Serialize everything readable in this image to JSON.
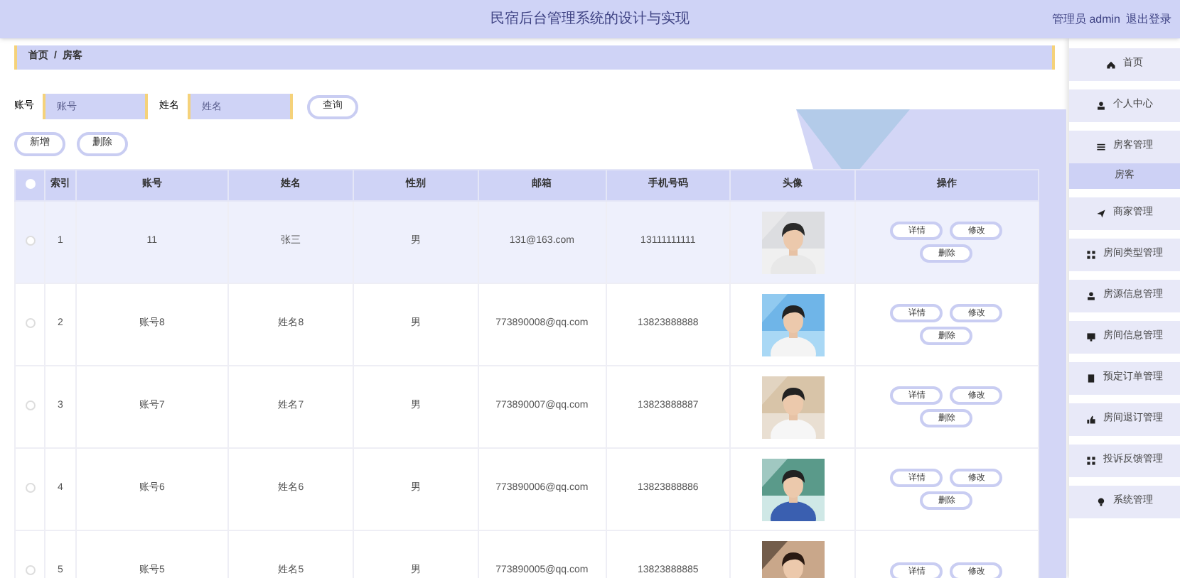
{
  "header": {
    "title": "民宿后台管理系统的设计与实现",
    "user": "管理员 admin",
    "logout": "退出登录"
  },
  "breadcrumb": [
    "首页",
    "/",
    "房客"
  ],
  "search": [
    {
      "label": "账号",
      "placeholder": "账号"
    },
    {
      "label": "姓名",
      "placeholder": "姓名"
    }
  ],
  "search_button": "查询",
  "actions": [
    "新增",
    "删除"
  ],
  "table": {
    "select_all": false,
    "columns": [
      "索引",
      "账号",
      "姓名",
      "性别",
      "邮箱",
      "手机号码",
      "头像",
      "操作"
    ],
    "rows": [
      {
        "checked": false,
        "hovered": true,
        "cells": [
          "1",
          "11",
          "张三",
          "男",
          "131@163.com",
          "13111111111"
        ],
        "avatar": {
          "kind": "picture"
        },
        "actions": [
          "详情",
          "修改",
          "删除"
        ]
      },
      {
        "checked": false,
        "hovered": false,
        "cells": [
          "2",
          "账号8",
          "姓名8",
          "男",
          "773890008@qq.com",
          "13823888888"
        ],
        "avatar": {
          "kind": "picture"
        },
        "actions": [
          "详情",
          "修改",
          "删除"
        ]
      },
      {
        "checked": false,
        "hovered": false,
        "cells": [
          "3",
          "账号7",
          "姓名7",
          "男",
          "773890007@qq.com",
          "13823888887"
        ],
        "avatar": {
          "kind": "picture"
        },
        "actions": [
          "详情",
          "修改",
          "删除"
        ]
      },
      {
        "checked": false,
        "hovered": false,
        "cells": [
          "4",
          "账号6",
          "姓名6",
          "男",
          "773890006@qq.com",
          "13823888886"
        ],
        "avatar": {
          "kind": "picture"
        },
        "actions": [
          "详情",
          "修改",
          "删除"
        ]
      },
      {
        "checked": false,
        "hovered": false,
        "cells": [
          "5",
          "账号5",
          "姓名5",
          "男",
          "773890005@qq.com",
          "13823888885"
        ],
        "avatar": {
          "kind": "picture"
        },
        "actions": [
          "详情",
          "修改"
        ]
      }
    ]
  },
  "sidebar": {
    "items": [
      {
        "label": "首页",
        "kind": "home",
        "selected": false
      },
      {
        "label": "个人中心",
        "kind": "user",
        "selected": false
      },
      {
        "label": "房客管理",
        "kind": "list",
        "selected": false,
        "children": [
          {
            "label": "房客",
            "selected": true
          }
        ]
      },
      {
        "label": "商家管理",
        "kind": "plane",
        "selected": false
      },
      {
        "label": "房间类型管理",
        "kind": "grid",
        "selected": false
      },
      {
        "label": "房源信息管理",
        "kind": "user",
        "selected": false
      },
      {
        "label": "房间信息管理",
        "kind": "monitor",
        "selected": false
      },
      {
        "label": "预定订单管理",
        "kind": "doc",
        "selected": false
      },
      {
        "label": "房间退订管理",
        "kind": "thumb",
        "selected": false
      },
      {
        "label": "投诉反馈管理",
        "kind": "grid",
        "selected": false
      },
      {
        "label": "系统管理",
        "kind": "bulb",
        "selected": false
      }
    ]
  }
}
